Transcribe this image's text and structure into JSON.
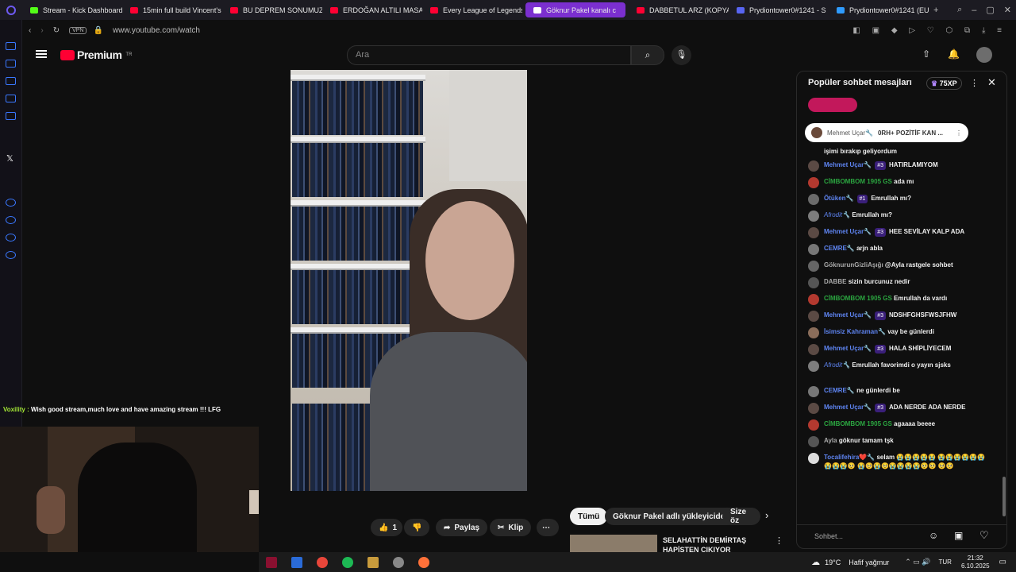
{
  "browser": {
    "tabs": [
      {
        "title": "Stream - Kick Dashboard",
        "color": "#53fc18"
      },
      {
        "title": "15min full build Vincent's",
        "color": "#ff0033"
      },
      {
        "title": "BU DEPREM SONUMUZ",
        "color": "#ff0033"
      },
      {
        "title": "ERDOĞAN ALTILI MASA",
        "color": "#ff0033"
      },
      {
        "title": "Every League of Legends",
        "color": "#ff0033"
      },
      {
        "title": "Göknur Pakel kanalı c",
        "color": "#ffffff",
        "active": true
      },
      {
        "title": "DABBETUL ARZ (KOPYA",
        "color": "#ff0033"
      },
      {
        "title": "Prydiontower0#1241 - S",
        "color": "#5865f2"
      },
      {
        "title": "Prydiontower0#1241 (EU",
        "color": "#2f9bff"
      }
    ],
    "vpn_label": "VPN",
    "url": "www.youtube.com/watch"
  },
  "youtube": {
    "logo_text": "Premium",
    "logo_sup": "TR",
    "search_placeholder": "Ara"
  },
  "stream_overlay": {
    "chat_user": "Voxility :",
    "chat_msg": "Wish good stream,much love and have amazing stream !!! LFG"
  },
  "controls": {
    "like_count": "1",
    "share_label": "Paylaş",
    "clip_label": "Klip",
    "chips": [
      "Tümü",
      "Göknur Pakel adlı yükleyiciden",
      "Size öz"
    ],
    "related_title_1": "SELAHATTİN DEMİRTAŞ",
    "related_title_2": "HAPİSTEN ÇIKIYOR"
  },
  "chat": {
    "header": "Popüler sohbet mesajları",
    "xp": "75XP",
    "pinned_user": "Mehmet Uçar🔧",
    "pinned_msg": "0RH+ POZİTİF KAN ...",
    "partial_msg": "işimi bırakıp geliyordum",
    "input_placeholder": "Sohbet...",
    "messages": [
      {
        "user": "Mehmet Uçar🔧",
        "cls": "blue",
        "badge": "#3",
        "text": "HATIRLAMIYOM"
      },
      {
        "user": "CİMBOMBOM 1905 GS",
        "cls": "green",
        "badge": "",
        "text": "ada mı"
      },
      {
        "user": "Ötüken🔧",
        "cls": "blue",
        "badge": "#1",
        "text": "Emrullah mı?"
      },
      {
        "user": "Afrodit🔧",
        "cls": "italic",
        "badge": "",
        "text": "Emrullah mı?"
      },
      {
        "user": "Mehmet Uçar🔧",
        "cls": "blue",
        "badge": "#3",
        "text": "HEE SEVİLAY KALP ADA"
      },
      {
        "user": "CEMRE🔧",
        "cls": "blue",
        "badge": "",
        "text": "arjn abla"
      },
      {
        "user": "GöknurunGizliAşığı",
        "cls": "",
        "badge": "",
        "text": "@Ayla rastgele sohbet"
      },
      {
        "user": "DABBE",
        "cls": "",
        "badge": "",
        "text": "sizin burcunuz nedir"
      },
      {
        "user": "CİMBOMBOM 1905 GS",
        "cls": "green",
        "badge": "",
        "text": "Emrullah da vardı"
      },
      {
        "user": "Mehmet Uçar🔧",
        "cls": "blue",
        "badge": "#3",
        "text": "NDSHFGHSFWSJFHW"
      },
      {
        "user": "İsimsiz Kahraman🔧",
        "cls": "blue",
        "badge": "",
        "text": "vay be günlerdi"
      },
      {
        "user": "Mehmet Uçar🔧",
        "cls": "blue",
        "badge": "#3",
        "text": "HALA SHİPLİYECEM"
      },
      {
        "user": "Afrodit🔧",
        "cls": "italic",
        "badge": "",
        "text": "Emrullah favorimdi o yayın sjsks"
      },
      {
        "user": "CEMRE🔧",
        "cls": "blue",
        "badge": "",
        "text": "ne günlerdi be"
      },
      {
        "user": "Mehmet Uçar🔧",
        "cls": "blue",
        "badge": "#3",
        "text": "ADA NERDE ADA NERDE"
      },
      {
        "user": "CİMBOMBOM 1905 GS",
        "cls": "green",
        "badge": "",
        "text": "agaaaa beeee"
      },
      {
        "user": "Ayla",
        "cls": "",
        "badge": "",
        "text": "göknur tamam tşk"
      },
      {
        "user": "Tocalifehira❤️🔧",
        "cls": "blue",
        "badge": "",
        "text": "selam 😭😭😭😭😭 😭😭😭😭😭😭😭😭😭🥺 😭🥺😭🥺😭😭😭😭🥺🥺 🥺🥺"
      }
    ]
  },
  "taskbar": {
    "weather": "19°C",
    "weather_desc": "Hafif yağmur",
    "lang": "TUR",
    "time": "21:32",
    "date": "6.10.2025"
  }
}
